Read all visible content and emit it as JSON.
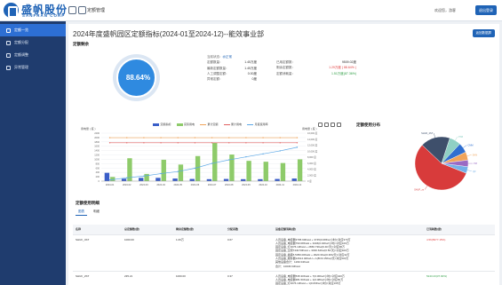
{
  "topbar": {
    "logo_text": "盛帆股份",
    "logo_sub": "SANFRAN CORP",
    "title": "定额管理",
    "user": "欢迎您，游客",
    "logout_label": "退出登录"
  },
  "sidebar": {
    "items": [
      {
        "label": "定额一览",
        "active": true
      },
      {
        "label": "定额分配",
        "active": false
      },
      {
        "label": "定额调整",
        "active": false
      },
      {
        "label": "异常管理",
        "active": false
      }
    ]
  },
  "page": {
    "title": "2024年度盛帆园区定额指标(2024-01至2024-12)--能效事业部",
    "button_label": "返回数据屏",
    "usage_heading": "定额剩余",
    "distribution_heading": "定额使用分布",
    "detail_heading": "定额使用明细"
  },
  "gauge": {
    "value": "88.64%",
    "fraction": 0.8864
  },
  "info": {
    "title_label": "当前状态：",
    "title_value": "@正常",
    "rows": [
      {
        "l1": "定额数量：",
        "v1": "1.45万度",
        "l2": "已用定额数：",
        "v2": "9509.02度",
        "cls2": ""
      },
      {
        "l1": "最新定额数量：",
        "v1": "1.45万度",
        "l2": "剩余定额数：",
        "v2": "1.29万度 ( 88.64% )",
        "cls2": "red"
      },
      {
        "l1": "人工调整定额：",
        "v1": "0.00度",
        "l2": "定额消耗量：",
        "v2": "1.51万度(87.36%)",
        "cls2": "green"
      },
      {
        "l1": "异常定额：",
        "v1": "0度",
        "l2": "",
        "v2": "",
        "cls2": ""
      }
    ]
  },
  "chart_legend": [
    {
      "name": "定额指标",
      "color": "#3a5ec8",
      "kind": "bar"
    },
    {
      "name": "实际用电",
      "color": "#8ecb6a",
      "kind": "bar"
    },
    {
      "name": "累计定额",
      "color": "#f0a45a",
      "kind": "line"
    },
    {
      "name": "累计用电",
      "color": "#e06060",
      "kind": "line"
    },
    {
      "name": "月度使用率",
      "color": "#5aa7e6",
      "kind": "line"
    }
  ],
  "axis_units": {
    "left": "用电量 ( 度 )",
    "right": "用电量 ( 度 )"
  },
  "chart_data": {
    "type": "bar",
    "categories": [
      "2024-01",
      "2024-02",
      "2024-03",
      "2024-04",
      "2024-05",
      "2024-06",
      "2024-07",
      "2024-08",
      "2024-09",
      "2024-10",
      "2024-11",
      "2024-12"
    ],
    "left_ticks": [
      "2200",
      "2000",
      "1800",
      "1600",
      "1400",
      "1200",
      "1000",
      "800",
      "600",
      "400",
      "200",
      "0"
    ],
    "right_ticks": [
      "16,000 度",
      "14,000 度",
      "12,000 度",
      "10,000 度",
      "8,000 度",
      "6,000 度",
      "4,000 度",
      "2,000 度",
      "0 度"
    ],
    "ylim_left": [
      0,
      2200
    ],
    "ylim_right": [
      0,
      16000
    ],
    "series": [
      {
        "name": "定额指标",
        "axis": "left",
        "color": "#3a5ec8",
        "values": [
          380,
          110,
          150,
          150,
          120,
          100,
          90,
          100,
          90,
          90,
          100,
          120
        ]
      },
      {
        "name": "实际用电",
        "axis": "left",
        "color": "#8ecb6a",
        "values": [
          190,
          1050,
          330,
          980,
          760,
          1150,
          1750,
          1220,
          930,
          890,
          830,
          1000
        ]
      },
      {
        "name": "累计定额",
        "axis": "right",
        "color": "#f0a45a",
        "values": [
          14500,
          14500,
          14500,
          14500,
          14500,
          14500,
          14500,
          14500,
          14500,
          14500,
          14500,
          14500
        ]
      },
      {
        "name": "累计用电",
        "axis": "right",
        "color": "#e06060",
        "values": [
          12800,
          12800,
          12800,
          12800,
          12800,
          12800,
          12800,
          12800,
          12800,
          12800,
          12800,
          12800
        ]
      },
      {
        "name": "月度使用率",
        "axis": "right",
        "color": "#5aa7e6",
        "values": [
          400,
          1100,
          1700,
          2500,
          3200,
          4300,
          5900,
          7100,
          8100,
          9100,
          10100,
          11300
        ]
      }
    ]
  },
  "pie": {
    "type": "pie",
    "slices": [
      {
        "name": "SHUF_xx",
        "value": 56,
        "color": "#d83b3b"
      },
      {
        "name": "SHUF_2ST",
        "value": 18,
        "color": "#3e4f6b"
      },
      {
        "name": "PSB",
        "value": 7,
        "color": "#8fd0c4"
      },
      {
        "name": "CMM",
        "value": 6,
        "color": "#2f6fd0"
      },
      {
        "name": "SHN",
        "value": 5,
        "color": "#f0a45a"
      },
      {
        "name": "PIZ",
        "value": 4,
        "color": "#9a6ac4"
      },
      {
        "name": "QZ",
        "value": 4,
        "color": "#74b0e8"
      }
    ]
  },
  "tabs": [
    "图表",
    "明细"
  ],
  "table": {
    "headers": [
      "名称",
      "总定额数(度)",
      "剩余定额数(度)",
      "分配系数",
      "设备定额消耗(度)",
      "已消耗数(度)"
    ],
    "rows": [
      {
        "name": "SHUF_4ST",
        "total": "1000.00",
        "remain": "1.06万",
        "coef": "0.67",
        "detail": [
          "人员设备_电控器3795.90KwH + 3745(0.08Kw/小时)=对应370万",
          "人员设备_电控器793.08KwH + 3446(0.02Kw/小时)=对应100万",
          "固定设备_灯3076.13KwH + 2650.73Kw(0.4h/天)=对应96万",
          "固定设备_空调7440.50KwH + 3030.62Kw(0.5h/天)=对应400万",
          "固定设备_插座5.5350.00KwH + 2920.3Kw(0.36h/天)=对应32万",
          "人员设备_服务器12614.40KwH + 1(8h/0.15Kw)/天=对应500万",
          "其他设备合计：1199.34KwH",
          "合计：10036.63KwH"
        ],
        "consumed": "4.56(5677.15%)",
        "consumed_cls": "red"
      },
      {
        "name": "SHUF_2ST",
        "total": "235.21",
        "remain": "1000.00",
        "coef": "0.37",
        "detail": [
          "人员设备_电控器535.30KwH + 7(0.06Kw/小时)=对应420万",
          "人员设备_电控器381.50KwH + 1(0.08Kw/小时)=对应50万",
          "固定设备_灯3076.13KwH + 1(0.06Kw/小时)=对应165万",
          "固定设备_空调7 179.00KwH + 1(0.51Kw/小时)=对应135万",
          "固定设备_插座4 891.60KwH + 1(2h/天)=对应120万"
        ],
        "consumed": "5243.23(37.90%)",
        "consumed_cls": "green"
      }
    ]
  }
}
